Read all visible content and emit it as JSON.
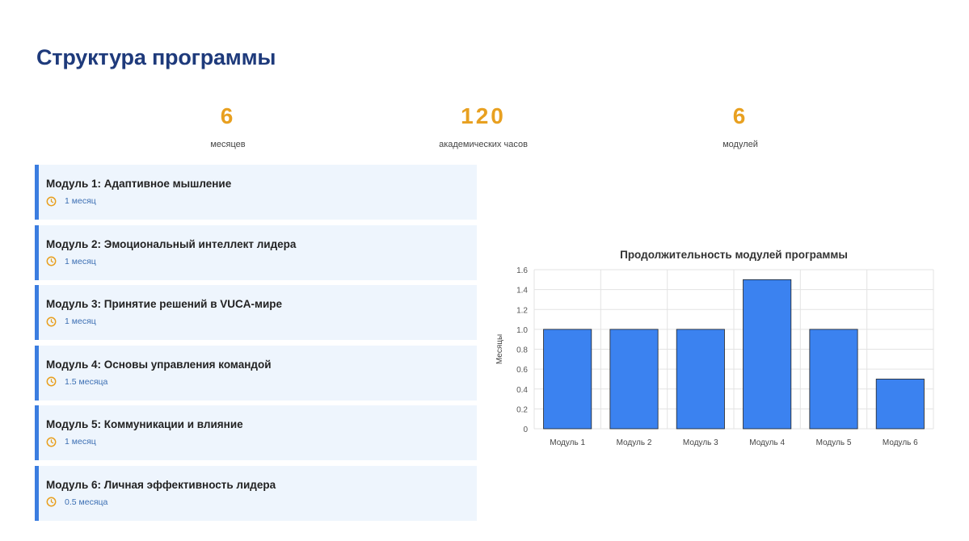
{
  "page": {
    "title": "Структура программы"
  },
  "stats": [
    {
      "value": "6",
      "label": "месяцев"
    },
    {
      "value": "120",
      "label": "академических часов"
    },
    {
      "value": "6",
      "label": "модулей"
    }
  ],
  "modules": [
    {
      "title": "Модуль 1: Адаптивное мышление",
      "duration": "1 месяц"
    },
    {
      "title": "Модуль 2: Эмоциональный интеллект лидера",
      "duration": "1 месяц"
    },
    {
      "title": "Модуль 3: Принятие решений в VUCA-мире",
      "duration": "1 месяц"
    },
    {
      "title": "Модуль 4: Основы управления командой",
      "duration": "1.5 месяца"
    },
    {
      "title": "Модуль 5: Коммуникации и влияние",
      "duration": "1 месяц"
    },
    {
      "title": "Модуль 6: Личная эффективность лидера",
      "duration": "0.5 месяца"
    }
  ],
  "icons": {
    "module_duration": "clock-icon"
  },
  "colors": {
    "title": "#1e3a7b",
    "accent": "#e8a020",
    "card_bg": "#eef5fd",
    "card_border": "#3b7de0",
    "bar": "#3b82f0"
  },
  "chart_data": {
    "type": "bar",
    "title": "Продолжительность модулей программы",
    "xlabel": "",
    "ylabel": "Месяцы",
    "categories": [
      "Модуль 1",
      "Модуль 2",
      "Модуль 3",
      "Модуль 4",
      "Модуль 5",
      "Модуль 6"
    ],
    "values": [
      1,
      1,
      1,
      1.5,
      1,
      0.5
    ],
    "ylim": [
      0,
      1.6
    ],
    "yticks": [
      "0",
      "0.2",
      "0.4",
      "0.6",
      "0.8",
      "1.0",
      "1.2",
      "1.4",
      "1.6"
    ],
    "grid": true,
    "legend": "none"
  }
}
